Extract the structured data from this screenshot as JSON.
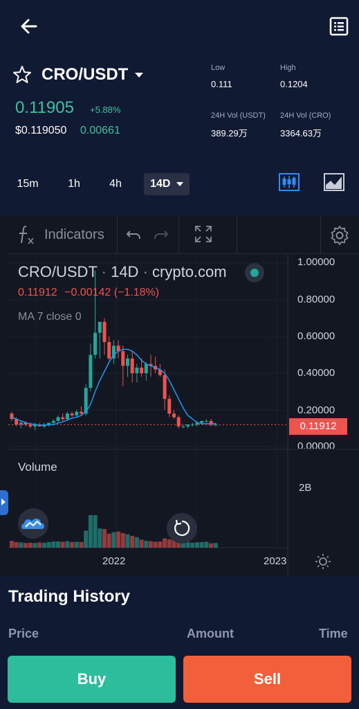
{
  "header": {
    "pair": "CRO/USDT",
    "price": "0.11905",
    "change_pct": "+5.88%",
    "usd_price": "$0.119050",
    "change_abs": "0.00661",
    "stats": {
      "low_label": "Low",
      "low_value": "0.111",
      "high_label": "High",
      "high_value": "0.1204",
      "vol_usdt_label": "24H Vol (USDT)",
      "vol_usdt_value": "389.29万",
      "vol_cro_label": "24H Vol (CRO)",
      "vol_cro_value": "3364.63万"
    }
  },
  "timeframes": [
    "15m",
    "1h",
    "4h",
    "14D"
  ],
  "active_timeframe": "14D",
  "colors": {
    "up": "#26a69a",
    "down": "#ef5350",
    "accent": "#3ec1a0",
    "ma": "#2196f3"
  },
  "chart_toolbar": {
    "indicators_label": "Indicators"
  },
  "chart_legend": {
    "symbol": "CRO/USDT",
    "interval": "14D",
    "exchange": "crypto.com",
    "last": "0.11912",
    "change": "−0.00142 (−1.18%)",
    "ma_label": "MA 7 close 0"
  },
  "chart_data": {
    "type": "candlestick",
    "price_axis": {
      "ticks": [
        "1.00000",
        "0.80000",
        "0.60000",
        "0.40000",
        "0.20000",
        "0.00000"
      ],
      "range": [
        0,
        1.0
      ]
    },
    "last_price_tag": "0.11912",
    "volume_label": "Volume",
    "volume_axis": {
      "ticks": [
        "2B"
      ]
    },
    "x_tick_labels": [
      "2022",
      "2023"
    ],
    "candles": [
      {
        "o": 0.18,
        "h": 0.19,
        "l": 0.14,
        "c": 0.15
      },
      {
        "o": 0.15,
        "h": 0.16,
        "l": 0.11,
        "c": 0.12
      },
      {
        "o": 0.12,
        "h": 0.14,
        "l": 0.1,
        "c": 0.13
      },
      {
        "o": 0.13,
        "h": 0.14,
        "l": 0.11,
        "c": 0.12
      },
      {
        "o": 0.12,
        "h": 0.13,
        "l": 0.1,
        "c": 0.11
      },
      {
        "o": 0.11,
        "h": 0.13,
        "l": 0.09,
        "c": 0.12
      },
      {
        "o": 0.12,
        "h": 0.13,
        "l": 0.11,
        "c": 0.11
      },
      {
        "o": 0.11,
        "h": 0.13,
        "l": 0.1,
        "c": 0.12
      },
      {
        "o": 0.12,
        "h": 0.13,
        "l": 0.11,
        "c": 0.13
      },
      {
        "o": 0.13,
        "h": 0.15,
        "l": 0.12,
        "c": 0.14
      },
      {
        "o": 0.14,
        "h": 0.17,
        "l": 0.13,
        "c": 0.16
      },
      {
        "o": 0.16,
        "h": 0.18,
        "l": 0.14,
        "c": 0.15
      },
      {
        "o": 0.15,
        "h": 0.19,
        "l": 0.14,
        "c": 0.18
      },
      {
        "o": 0.18,
        "h": 0.19,
        "l": 0.16,
        "c": 0.17
      },
      {
        "o": 0.17,
        "h": 0.2,
        "l": 0.16,
        "c": 0.19
      },
      {
        "o": 0.19,
        "h": 0.22,
        "l": 0.17,
        "c": 0.18
      },
      {
        "o": 0.18,
        "h": 0.34,
        "l": 0.17,
        "c": 0.32
      },
      {
        "o": 0.32,
        "h": 0.56,
        "l": 0.3,
        "c": 0.5
      },
      {
        "o": 0.5,
        "h": 0.96,
        "l": 0.48,
        "c": 0.62
      },
      {
        "o": 0.62,
        "h": 0.68,
        "l": 0.48,
        "c": 0.68
      },
      {
        "o": 0.68,
        "h": 0.7,
        "l": 0.5,
        "c": 0.57
      },
      {
        "o": 0.57,
        "h": 0.6,
        "l": 0.47,
        "c": 0.48
      },
      {
        "o": 0.48,
        "h": 0.58,
        "l": 0.45,
        "c": 0.55
      },
      {
        "o": 0.55,
        "h": 0.58,
        "l": 0.48,
        "c": 0.52
      },
      {
        "o": 0.52,
        "h": 0.55,
        "l": 0.33,
        "c": 0.44
      },
      {
        "o": 0.44,
        "h": 0.5,
        "l": 0.38,
        "c": 0.48
      },
      {
        "o": 0.48,
        "h": 0.52,
        "l": 0.35,
        "c": 0.4
      },
      {
        "o": 0.4,
        "h": 0.45,
        "l": 0.35,
        "c": 0.43
      },
      {
        "o": 0.43,
        "h": 0.48,
        "l": 0.38,
        "c": 0.4
      },
      {
        "o": 0.4,
        "h": 0.46,
        "l": 0.36,
        "c": 0.45
      },
      {
        "o": 0.45,
        "h": 0.5,
        "l": 0.38,
        "c": 0.44
      },
      {
        "o": 0.44,
        "h": 0.49,
        "l": 0.4,
        "c": 0.42
      },
      {
        "o": 0.42,
        "h": 0.45,
        "l": 0.38,
        "c": 0.39
      },
      {
        "o": 0.39,
        "h": 0.42,
        "l": 0.2,
        "c": 0.26
      },
      {
        "o": 0.26,
        "h": 0.28,
        "l": 0.16,
        "c": 0.18
      },
      {
        "o": 0.18,
        "h": 0.2,
        "l": 0.15,
        "c": 0.16
      },
      {
        "o": 0.16,
        "h": 0.17,
        "l": 0.1,
        "c": 0.11
      },
      {
        "o": 0.11,
        "h": 0.12,
        "l": 0.1,
        "c": 0.11
      },
      {
        "o": 0.11,
        "h": 0.12,
        "l": 0.1,
        "c": 0.12
      },
      {
        "o": 0.12,
        "h": 0.13,
        "l": 0.11,
        "c": 0.12
      },
      {
        "o": 0.12,
        "h": 0.14,
        "l": 0.11,
        "c": 0.13
      },
      {
        "o": 0.13,
        "h": 0.14,
        "l": 0.12,
        "c": 0.14
      },
      {
        "o": 0.14,
        "h": 0.15,
        "l": 0.13,
        "c": 0.14
      },
      {
        "o": 0.14,
        "h": 0.15,
        "l": 0.11,
        "c": 0.12
      },
      {
        "o": 0.12,
        "h": 0.13,
        "l": 0.11,
        "c": 0.12
      }
    ],
    "ma7": [
      0.16,
      0.15,
      0.14,
      0.13,
      0.125,
      0.12,
      0.118,
      0.117,
      0.118,
      0.12,
      0.128,
      0.135,
      0.145,
      0.155,
      0.16,
      0.17,
      0.19,
      0.23,
      0.3,
      0.36,
      0.41,
      0.46,
      0.5,
      0.52,
      0.53,
      0.53,
      0.52,
      0.5,
      0.47,
      0.45,
      0.44,
      0.43,
      0.42,
      0.4,
      0.36,
      0.31,
      0.26,
      0.21,
      0.17,
      0.15,
      0.13,
      0.125,
      0.125,
      0.125,
      0.125
    ],
    "volumes": [
      0.22,
      0.18,
      0.17,
      0.15,
      0.16,
      0.15,
      0.17,
      0.16,
      0.18,
      0.2,
      0.2,
      0.19,
      0.21,
      0.18,
      0.19,
      0.18,
      0.55,
      1.05,
      1.05,
      0.62,
      0.6,
      0.45,
      0.5,
      0.52,
      0.47,
      0.43,
      0.38,
      0.34,
      0.26,
      0.22,
      0.21,
      0.19,
      0.2,
      0.3,
      0.27,
      0.25,
      0.2,
      0.19,
      0.18,
      0.16,
      0.17,
      0.18,
      0.19,
      0.14,
      0.15
    ]
  },
  "trading_history": {
    "title": "Trading History",
    "col_price": "Price",
    "col_amount": "Amount",
    "col_time": "Time"
  },
  "actions": {
    "buy": "Buy",
    "sell": "Sell",
    "buy_color": "#2ebd9c",
    "sell_color": "#f1603b"
  }
}
